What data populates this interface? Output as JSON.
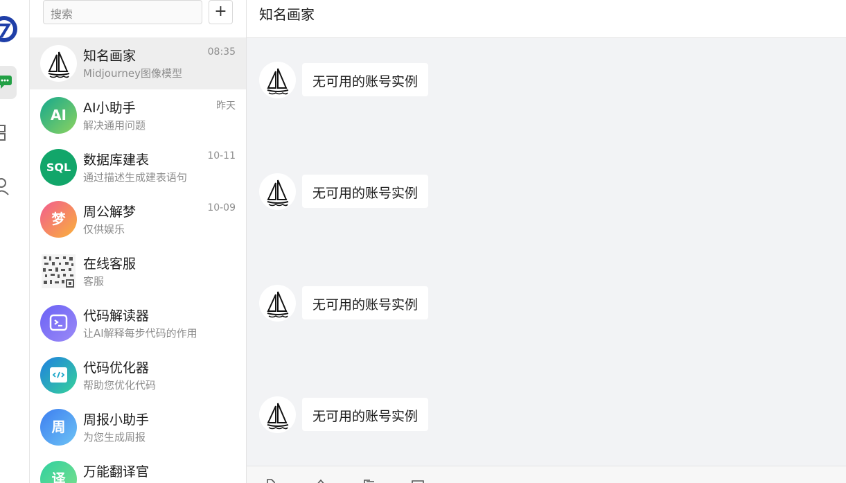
{
  "rail": {
    "icons": [
      "logo-icon",
      "chat-icon",
      "apps-icon",
      "user-icon"
    ],
    "accent": "#22a045",
    "logo_color": "#1f3fa8"
  },
  "list": {
    "search_placeholder": "搜索",
    "add_label": "+",
    "conversations": [
      {
        "name": "知名画家",
        "sub": "Midjourney图像模型",
        "time": "08:35",
        "avatar": "sailboat-icon",
        "active": true
      },
      {
        "name": "AI小助手",
        "sub": "解决通用问题",
        "time": "昨天",
        "avatar_text": "AI",
        "color": "#2bb673"
      },
      {
        "name": "数据库建表",
        "sub": "通过描述生成建表语句",
        "time": "10-11",
        "avatar_text": "SQL",
        "color": "#12a66a"
      },
      {
        "name": "周公解梦",
        "sub": "仅供娱乐",
        "time": "10-09",
        "avatar_text": "梦",
        "color": "#f6884f"
      },
      {
        "name": "在线客服",
        "sub": "客服",
        "time": "",
        "avatar": "qr-code-icon"
      },
      {
        "name": "代码解读器",
        "sub": "让AI解释每步代码的作用",
        "time": "",
        "avatar": "terminal-icon",
        "color": "#7a6cf0"
      },
      {
        "name": "代码优化器",
        "sub": "帮助您优化代码",
        "time": "",
        "avatar": "code-icon",
        "color": "#1aa6c9"
      },
      {
        "name": "周报小助手",
        "sub": "为您生成周报",
        "time": "",
        "avatar_text": "周",
        "color": "#4a8ff0"
      },
      {
        "name": "万能翻译官",
        "sub": "",
        "time": "",
        "avatar_text": "译",
        "color": "#3ccf9a"
      }
    ]
  },
  "chat": {
    "title": "知名画家",
    "messages": [
      {
        "text": "无可用的账号实例",
        "avatar": "sailboat-icon"
      },
      {
        "text": "无可用的账号实例",
        "avatar": "sailboat-icon"
      },
      {
        "text": "无可用的账号实例",
        "avatar": "sailboat-icon"
      },
      {
        "text": "无可用的账号实例",
        "avatar": "sailboat-icon"
      }
    ]
  }
}
